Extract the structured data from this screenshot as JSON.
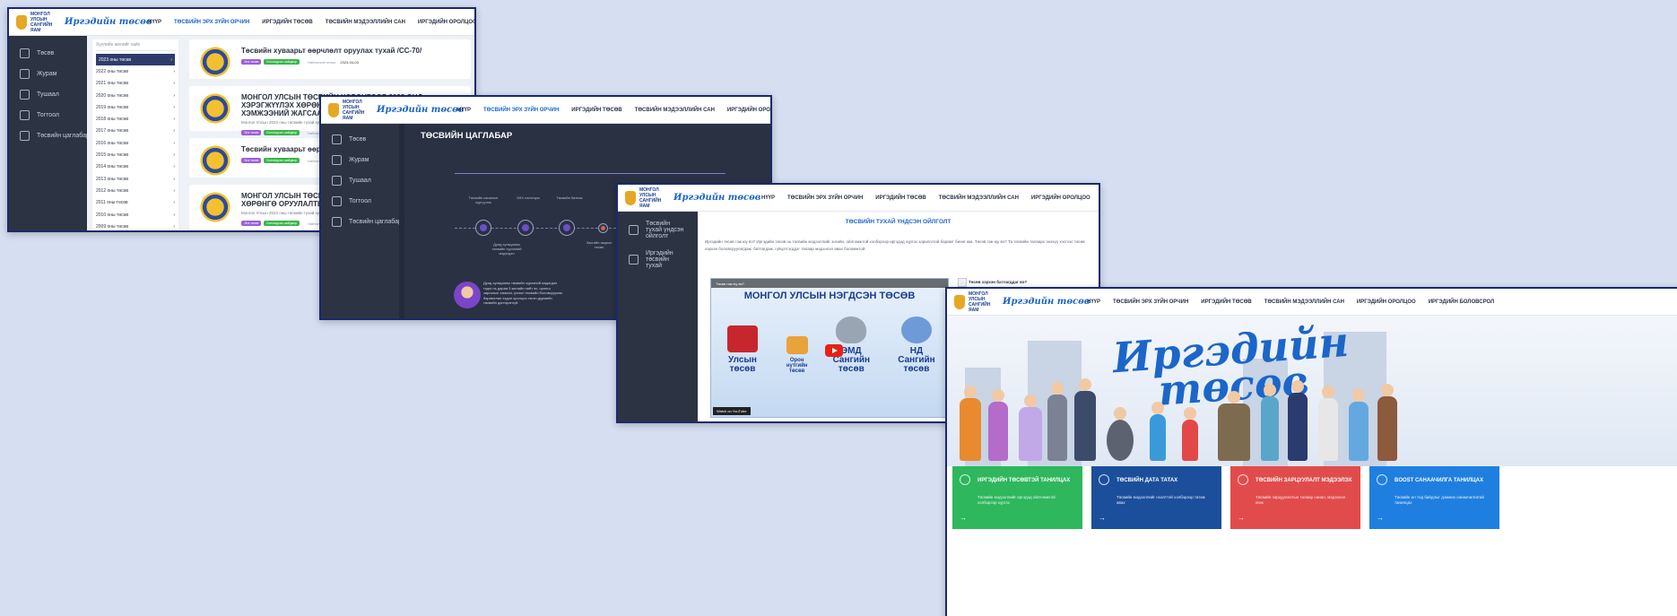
{
  "site": {
    "org_logo_text": "МОНГОЛ УЛСЫН САНГИЙН ЯАМ",
    "brand_text": "Иргэдийн төсөв",
    "nav": [
      "НҮҮР",
      "ТӨСВИЙН ЭРХ ЗҮЙН ОРЧИН",
      "ИРГЭДИЙН ТӨСӨВ",
      "ТӨСВИЙН МЭДЭЭЛЛИЙН САН",
      "ИРГЭДИЙН ОРОЛЦОО",
      "ИРГЭДИЙН БОЛОВСРОЛ"
    ]
  },
  "shot1": {
    "sidebar": [
      "Төсөв",
      "Журам",
      "Тушаал",
      "Тогтоол",
      "Төсвийн цаглабар"
    ],
    "search_placeholder": "Хуулийн жилийг хайх",
    "years": [
      "2023 оны төсөв",
      "2022 оны төсөв",
      "2021 оны төсөв",
      "2020 оны төсөв",
      "2019 оны төсөв",
      "2018 оны төсөв",
      "2017 оны төсөв",
      "2016 оны төсөв",
      "2015 оны төсөв",
      "2014 оны төсөв",
      "2013 оны төсөв",
      "2012 оны төсөв",
      "2011 оны төсөв",
      "2010 оны төсөв",
      "2009 оны төсөв"
    ],
    "cards": [
      {
        "title": "Төсвийн хуваарьт өөрчлөлт оруулах тухай /СС-70/",
        "desc": "",
        "tag1": "Энэ төсөв",
        "tag2": "Батлагдсан шийдвэр",
        "date_label": "Нийтэлсэн огноо",
        "date": "2023-04-03"
      },
      {
        "title": "МОНГОЛ УЛСЫН ТӨСВИЙН ХӨРӨНГӨӨР 2023 ОНД ХЭРЭГЖҮҮЛЭХ ХӨРӨНГӨ ОРУУЛАЛТЫН ТӨСӨЛ, АРГА ХЭМЖЭЭНИЙ ЖАГСААЛТ",
        "desc": "Монгол Улсын 2023 оны төсвийн тухай хуульд заасан хөрөнгө оруулалтын төсөл, арга хэмжээний жагсаалт",
        "tag1": "Энэ төсөв",
        "tag2": "Батлагдсан шийдвэр",
        "date_label": "Нийтэлсэн огноо",
        "date": ""
      },
      {
        "title": "Төсвийн хуваарьт өөрчлөлт оруулах тухай",
        "desc": "",
        "tag1": "Энэ төсөв",
        "tag2": "Батлагдсан шийдвэр",
        "date_label": "Нийтэлсэн огноо",
        "date": ""
      },
      {
        "title": "МОНГОЛ УЛСЫН ТӨСВИЙН ХӨРӨНГӨӨР ХЭРЭГЖҮҮЛЭХ ХӨРӨНГӨ ОРУУЛАЛТЫН",
        "desc": "Монгол Улсын 2023 оны төсвийн тухай хуульд заасан",
        "tag1": "Энэ төсөв",
        "tag2": "Батлагдсан шийдвэр",
        "date_label": "Нийтэлсэн огноо",
        "date": ""
      }
    ]
  },
  "shot2": {
    "sidebar": [
      "Төсөв",
      "Журам",
      "Тушаал",
      "Тогтоол",
      "Төсвийн цаглабар"
    ],
    "title": "ТӨСВИЙН ЦАГЛАБАР",
    "steps_top": [
      "Төсвийн саналын хүргүүлэх",
      "УИХ хэлэлцэх",
      "Төсвийн батлах"
    ],
    "steps_bottom": [
      "Дунд хугацааны төсвийн хүрээний мэдэгдэл",
      "Засгийн газрын төсөл"
    ],
    "speech": "Дунд хугацааны төсвийн хүрээний мэдэгдэл гэдэг нь дараа 3 жилийн нийт эх, орлого зарлагын хэмжээ, улсын төсвийн боловсруулах баримтлал хэдэн оролцоо гэсэн дүрмийн төсвийн дэлгэрэнгүй"
  },
  "shot3": {
    "sidebar": [
      "Төсвийн тухай үндсэн ойлголт",
      "Иргэдийн төсвийн тухай"
    ],
    "title": "ТӨСВИЙН ТУХАЙ ҮНДСЭН ОЙЛГОЛТ",
    "paragraph": "Иргэдийн төсөв гэж юу вэ? Иргэдийн төсөв нь төсвийн мэдээллийг энгийн, ойлгомжтой хэлбэрээр иргэдэд хүргэх зорилготой баримт бичиг юм. Төсөв гэж юу вэ? Та төсвийн талаарх энэхүү хэсгээс төсөв хэрхэн боловсруулагдаж, батлагдаж, гүйцэтгэгддэг талаар мэдээлэл авах боломжтой.",
    "video_bar": "Төсөв гэж юу вэ?",
    "video_title": "МОНГОЛ УЛСЫН НЭГДСЭН ТӨСӨВ",
    "video_cols": [
      "Улсын төсөв",
      "Орон нутгийн төсөв",
      "ЭМД Сангийн төсөв",
      "НД Сангийн төсөв"
    ],
    "watch_on": "Watch on YouTube",
    "side_question": "Төсөв хэрхэн батлагддаг вэ?"
  },
  "shot4": {
    "hero_line1": "Иргэдийн",
    "hero_line2": "төсөв",
    "tiles": [
      {
        "title": "ИРГЭДИЙН ТӨСӨВТЭЙ ТАНИЛЦАХ",
        "text": "Төсвийн мэдээллийг иргэдэд ойлгомжтой хэлбэрээр хүргэх",
        "color": "#2eb75d"
      },
      {
        "title": "ТӨСВИЙН ДАТА ТАТАХ",
        "text": "Төсвийн мэдээллийг нээлттэй хэлбэрээр татаж авах",
        "color": "#1b4e9b"
      },
      {
        "title": "ТӨСВИЙН ЗАРЦУУЛАЛТ МЭДЭЭЛЭХ",
        "text": "Төсвийн зарцуулалтын талаар санал, мэдээлэл өгөх",
        "color": "#e24b4b"
      },
      {
        "title": "BOOST САНААЧИЛГА ТАНИЛЦАХ",
        "text": "Төсвийн ил тод байдлыг дэмжих санаачилгатай танилцах",
        "color": "#1f7fe0"
      }
    ]
  }
}
